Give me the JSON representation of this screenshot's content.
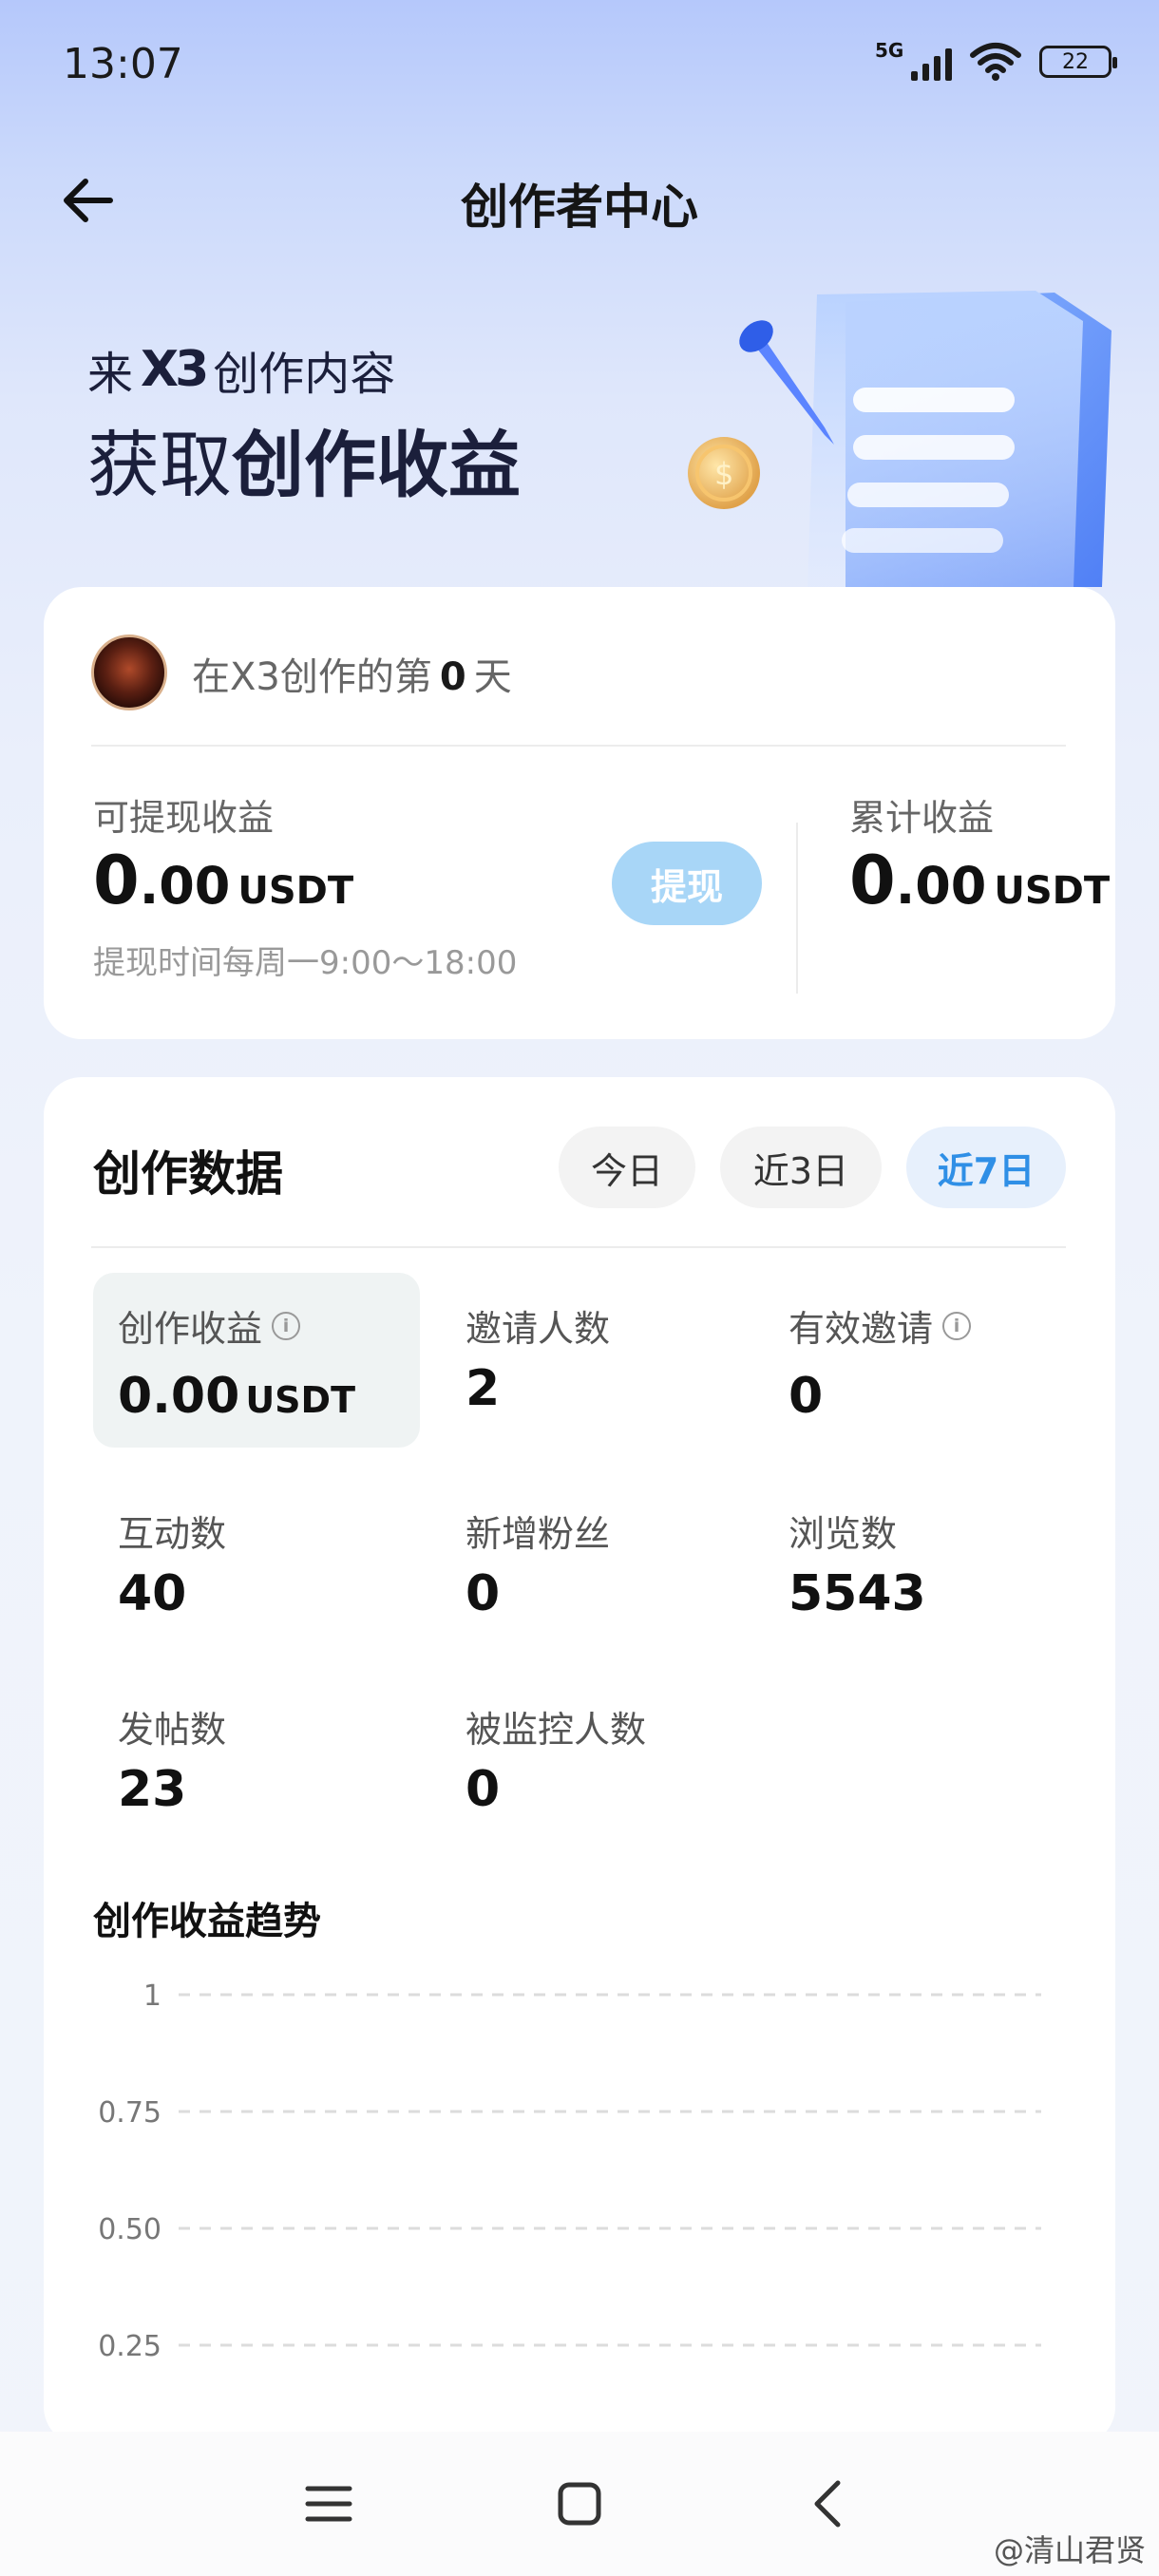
{
  "status": {
    "time": "13:07",
    "network": "5G",
    "battery": "22"
  },
  "header": {
    "title": "创作者中心"
  },
  "hero": {
    "line1_prefix": "来",
    "logo_text": "X3",
    "line1_suffix": "创作内容",
    "line2_normal": "获取",
    "line2_bold": "创作收益"
  },
  "earnings": {
    "days_prefix": "在X3创作的第",
    "days_value": "0",
    "days_suffix": "天",
    "withdrawable_label": "可提现收益",
    "withdrawable_int": "0",
    "withdrawable_dec": ".00",
    "withdrawable_unit": "USDT",
    "withdraw_button": "提现",
    "withdraw_note": "提现时间每周一9:00～18:00",
    "total_label": "累计收益",
    "total_int": "0",
    "total_dec": ".00",
    "total_unit": "USDT"
  },
  "stats": {
    "title": "创作数据",
    "tabs": [
      {
        "label": "今日",
        "active": false
      },
      {
        "label": "近3日",
        "active": false
      },
      {
        "label": "近7日",
        "active": true
      }
    ],
    "items": [
      {
        "label": "创作收益",
        "value": "0.00",
        "unit": "USDT",
        "info": true
      },
      {
        "label": "邀请人数",
        "value": "2"
      },
      {
        "label": "有效邀请",
        "value": "0",
        "info": true
      },
      {
        "label": "互动数",
        "value": "40"
      },
      {
        "label": "新增粉丝",
        "value": "0"
      },
      {
        "label": "浏览数",
        "value": "5543"
      },
      {
        "label": "发帖数",
        "value": "23"
      },
      {
        "label": "被监控人数",
        "value": "0"
      }
    ],
    "info_glyph": "i"
  },
  "chart_data": {
    "type": "line",
    "title": "创作收益趋势",
    "yticks": [
      "1",
      "0.75",
      "0.50",
      "0.25"
    ],
    "ylim": [
      0,
      1
    ],
    "grid": true,
    "series": []
  },
  "watermark": "@清山君贤",
  "colors": {
    "accent": "#2f8fe6",
    "withdraw_button": "#a8d6f7",
    "highlight_bg": "#eff3f3"
  }
}
